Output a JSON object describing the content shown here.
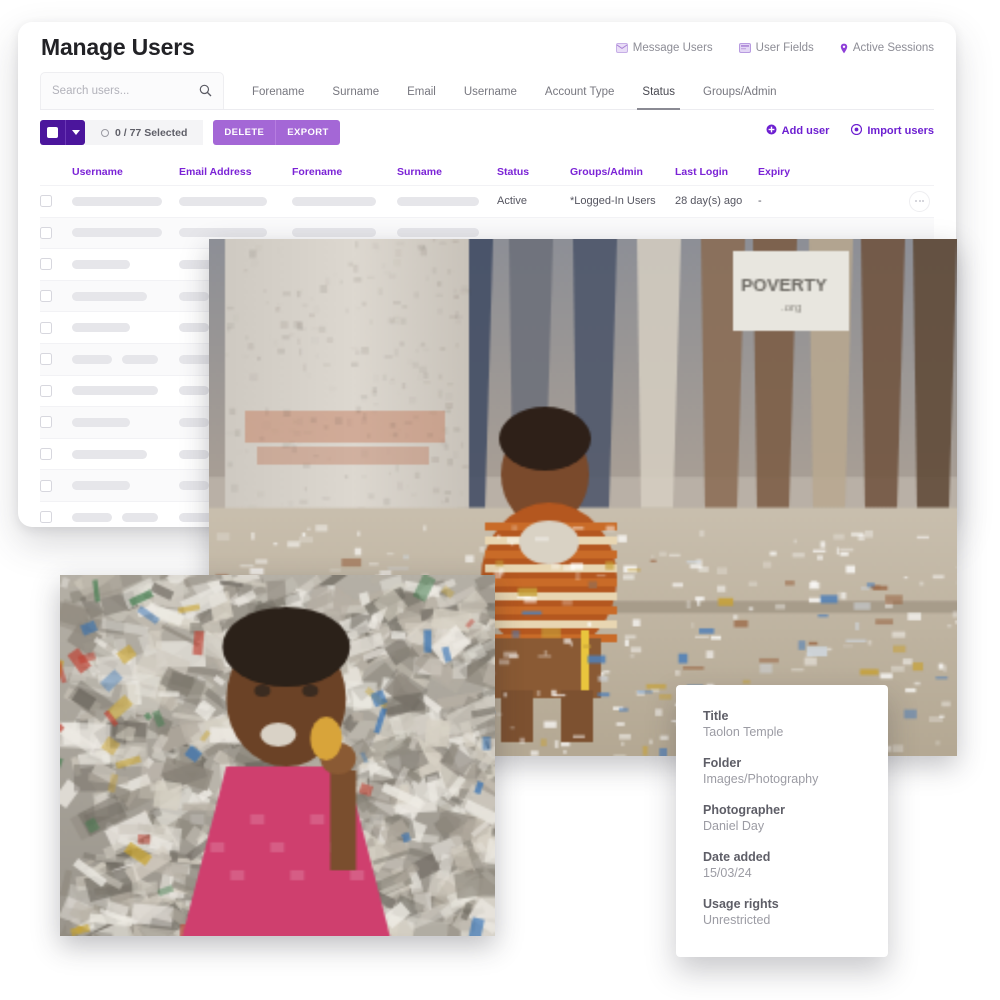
{
  "card": {
    "title": "Manage Users",
    "head_actions": [
      {
        "label": "Message Users",
        "icon": "envelope-icon"
      },
      {
        "label": "User Fields",
        "icon": "form-fields-icon"
      },
      {
        "label": "Active Sessions",
        "icon": "pin-icon"
      }
    ],
    "search": {
      "placeholder": "Search users...",
      "value": "",
      "icon": "search-icon"
    },
    "tabs": [
      {
        "label": "Forename",
        "active": false
      },
      {
        "label": "Surname",
        "active": false
      },
      {
        "label": "Email",
        "active": false
      },
      {
        "label": "Username",
        "active": false
      },
      {
        "label": "Account Type",
        "active": false
      },
      {
        "label": "Status",
        "active": true
      },
      {
        "label": "Groups/Admin",
        "active": false
      }
    ],
    "toolbar": {
      "select_all_icon": "checkbox-icon",
      "select_dropdown_icon": "chevron-down-icon",
      "selection_count": "0 / 77 Selected",
      "delete_label": "DELETE",
      "export_label": "EXPORT",
      "add_user_label": "Add user",
      "add_user_icon": "plus-circle-icon",
      "import_users_label": "Import users",
      "import_users_icon": "upload-circle-icon"
    },
    "table": {
      "columns": [
        "Username",
        "Email Address",
        "Forename",
        "Surname",
        "Status",
        "Groups/Admin",
        "Last Login",
        "Expiry"
      ],
      "rows": [
        {
          "loaded": true,
          "status": "Active",
          "groups": "*Logged-In Users",
          "last_login": "28 day(s) ago",
          "expiry": "-",
          "menu_icon": "more-options-icon"
        },
        {
          "loaded": false,
          "skeleton": [
            90,
            88,
            84,
            82
          ]
        },
        {
          "loaded": false,
          "skeleton": [
            58,
            58,
            0,
            0
          ]
        },
        {
          "loaded": false,
          "skeleton": [
            75,
            30,
            0,
            0
          ]
        },
        {
          "loaded": false,
          "skeleton": [
            58,
            30,
            0,
            0
          ]
        },
        {
          "loaded": false,
          "skeleton": [
            40,
            36,
            30,
            0
          ]
        },
        {
          "loaded": false,
          "skeleton": [
            86,
            30,
            0,
            0
          ]
        },
        {
          "loaded": false,
          "skeleton": [
            58,
            30,
            0,
            0
          ]
        },
        {
          "loaded": false,
          "skeleton": [
            75,
            30,
            0,
            0
          ]
        },
        {
          "loaded": false,
          "skeleton": [
            58,
            30,
            0,
            0
          ]
        },
        {
          "loaded": false,
          "skeleton": [
            40,
            36,
            30,
            0
          ]
        },
        {
          "loaded": false,
          "skeleton": [
            67,
            30,
            0,
            0
          ]
        }
      ]
    },
    "colors": {
      "brand_purple": "#7b23d6",
      "deep_purple": "#4b159c",
      "link_purple": "#6d1fd1",
      "pill_purple": "#a467d6"
    }
  },
  "meta_panel": {
    "items": [
      {
        "label": "Title",
        "value": "Taolon Temple"
      },
      {
        "label": "Folder",
        "value": "Images/Photography"
      },
      {
        "label": "Photographer",
        "value": "Daniel Day"
      },
      {
        "label": "Date added",
        "value": "15/03/24"
      },
      {
        "label": "Usage rights",
        "value": "Unrestricted"
      }
    ]
  },
  "photos": [
    {
      "name": "photo-child-on-kerb",
      "alt": "Child sitting on concrete kerb amid litter"
    },
    {
      "name": "photo-child-in-pink",
      "alt": "Child in pink dress standing among waste"
    }
  ]
}
